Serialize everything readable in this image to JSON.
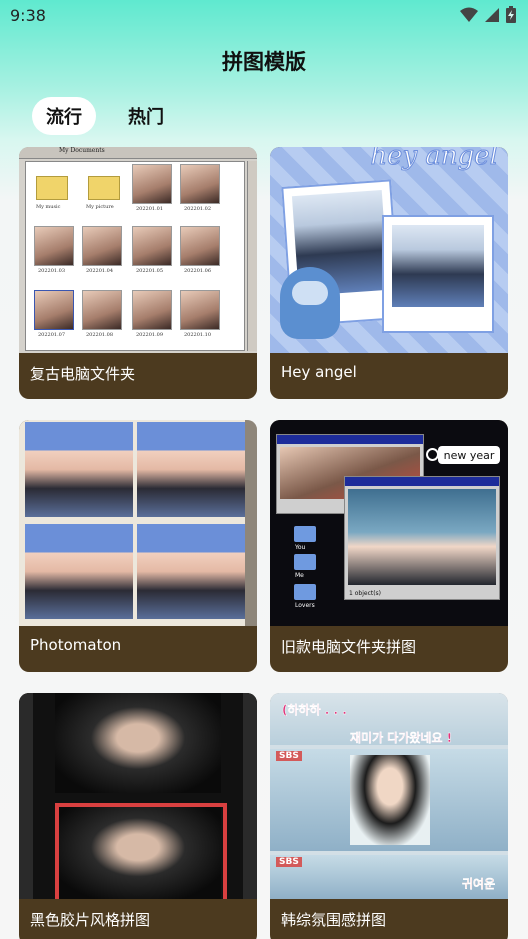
{
  "status_bar": {
    "time": "9:38",
    "icons": [
      "wifi-icon",
      "signal-icon",
      "battery-icon"
    ]
  },
  "header": {
    "title": "拼图模版"
  },
  "tabs": [
    {
      "label": "流行",
      "active": true
    },
    {
      "label": "热门",
      "active": false
    }
  ],
  "colors": {
    "card_footer": "#4c3a1f",
    "header_gradient_top": "#5fe9cf",
    "page_bg": "#f6f6f6"
  },
  "templates": [
    {
      "label": "复古电脑文件夹"
    },
    {
      "label": "Hey angel"
    },
    {
      "label": "Photomaton"
    },
    {
      "label": "旧款电脑文件夹拼图"
    },
    {
      "label": "黑色胶片风格拼图"
    },
    {
      "label": "韩综氛围感拼图"
    }
  ],
  "thumbs": {
    "retro_folder": {
      "path": "My Documents",
      "folders": [
        "My music",
        "My picture"
      ],
      "files": [
        "202201.01",
        "202201.02",
        "202201.03",
        "202201.04",
        "202201.05",
        "202201.06",
        "202201.07",
        "202201.08",
        "202201.09",
        "202201.10"
      ]
    },
    "hey_angel": {
      "headline": "hey angel"
    },
    "old_folder": {
      "search_text": "new year",
      "folders": [
        "You",
        "Me",
        "Lovers"
      ],
      "status": "1 object(s)"
    },
    "korean_variety": {
      "captions": [
        "(하하하 . . .",
        "재미가 다가왔네요 !",
        "귀여운"
      ],
      "channel": "SBS"
    }
  }
}
